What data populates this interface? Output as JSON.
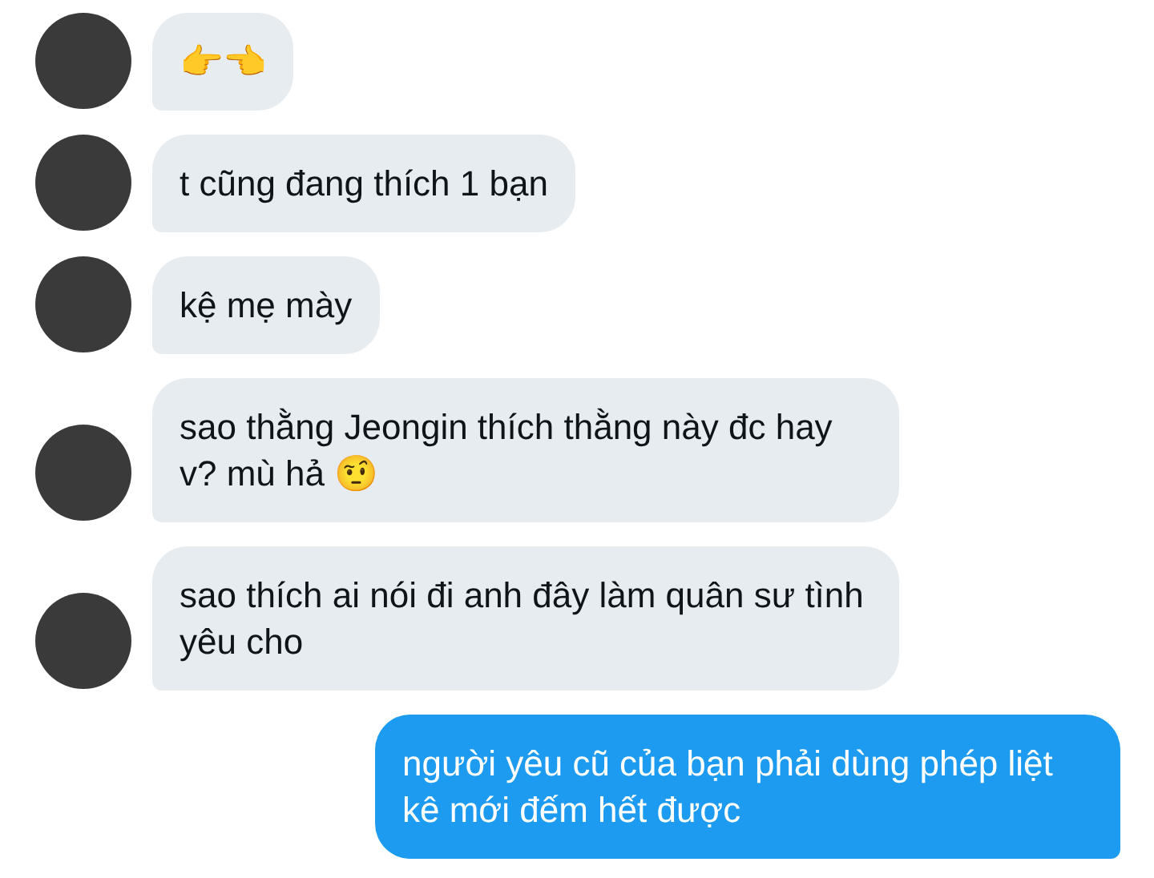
{
  "messages": [
    {
      "kind": "received",
      "text": "👉👈"
    },
    {
      "kind": "received",
      "text": "t cũng đang thích 1 bạn"
    },
    {
      "kind": "received",
      "text": "kệ mẹ mày"
    },
    {
      "kind": "received",
      "text": "sao thằng Jeongin thích thằng này đc hay v? mù hả 🤨"
    },
    {
      "kind": "received",
      "text": "sao thích ai nói đi anh đây làm quân sư tình yêu cho"
    },
    {
      "kind": "sent",
      "text": "người yêu cũ của bạn phải dùng phép liệt kê mới đếm hết được"
    }
  ]
}
